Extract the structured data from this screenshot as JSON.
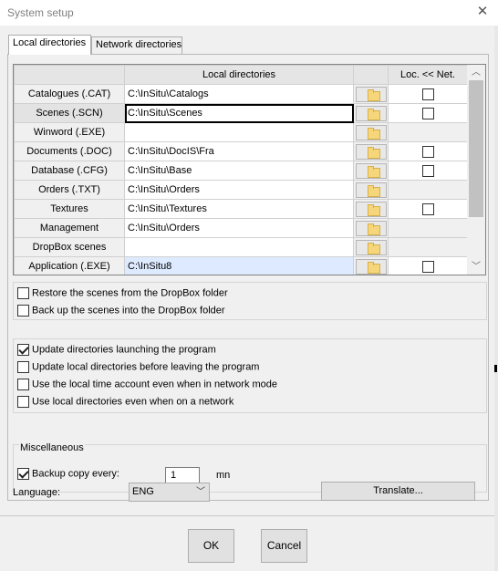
{
  "window": {
    "title": "System setup"
  },
  "tabs": [
    {
      "label": "Local directories",
      "active": true
    },
    {
      "label": "Network directories",
      "active": false
    }
  ],
  "grid": {
    "column_header": "Local directories",
    "loc_net_header": "Loc. << Net.",
    "rows": [
      {
        "label": "Catalogues (.CAT)",
        "path": "C:\\InSitu\\Catalogs",
        "has_check": true,
        "checked": false
      },
      {
        "label": "Scenes (.SCN)",
        "path": "C:\\InSitu\\Scenes",
        "has_check": true,
        "checked": false
      },
      {
        "label": "Winword (.EXE)",
        "path": "",
        "has_check": false,
        "checked": false
      },
      {
        "label": "Documents (.DOC)",
        "path": "C:\\InSitu\\DocIS\\Fra",
        "has_check": true,
        "checked": false
      },
      {
        "label": "Database (.CFG)",
        "path": "C:\\InSitu\\Base",
        "has_check": true,
        "checked": false
      },
      {
        "label": "Orders (.TXT)",
        "path": "C:\\InSitu\\Orders",
        "has_check": false,
        "checked": false
      },
      {
        "label": "Textures",
        "path": "C:\\InSitu\\Textures",
        "has_check": true,
        "checked": false
      },
      {
        "label": "Management",
        "path": "C:\\InSitu\\Orders",
        "has_check": false,
        "checked": false
      },
      {
        "label": "DropBox scenes",
        "path": "",
        "has_check": false,
        "checked": false
      },
      {
        "label": "Application (.EXE)",
        "path": "C:\\InSitu8",
        "has_check": true,
        "checked": false
      }
    ]
  },
  "dropbox_options": [
    {
      "label": "Restore the scenes from the DropBox folder",
      "checked": false
    },
    {
      "label": "Back up the scenes into the DropBox folder",
      "checked": false
    }
  ],
  "directory_options": [
    {
      "label": "Update directories launching the program",
      "checked": true
    },
    {
      "label": "Update local directories before leaving the program",
      "checked": false
    },
    {
      "label": "Use the local time account even when in network mode",
      "checked": false
    },
    {
      "label": "Use local directories even when on a network",
      "checked": false
    }
  ],
  "misc": {
    "group_title": "Miscellaneous",
    "backup_label": "Backup copy every:",
    "backup_checked": true,
    "backup_value": "1",
    "unit": "mn"
  },
  "language": {
    "label": "Language:",
    "value": "ENG",
    "translate_label": "Translate..."
  },
  "buttons": {
    "ok": "OK",
    "cancel": "Cancel"
  },
  "icons": {
    "close": "close-icon",
    "folder": "folder-icon",
    "scroll_up": "chevron-up-icon",
    "scroll_down": "chevron-down-icon"
  }
}
